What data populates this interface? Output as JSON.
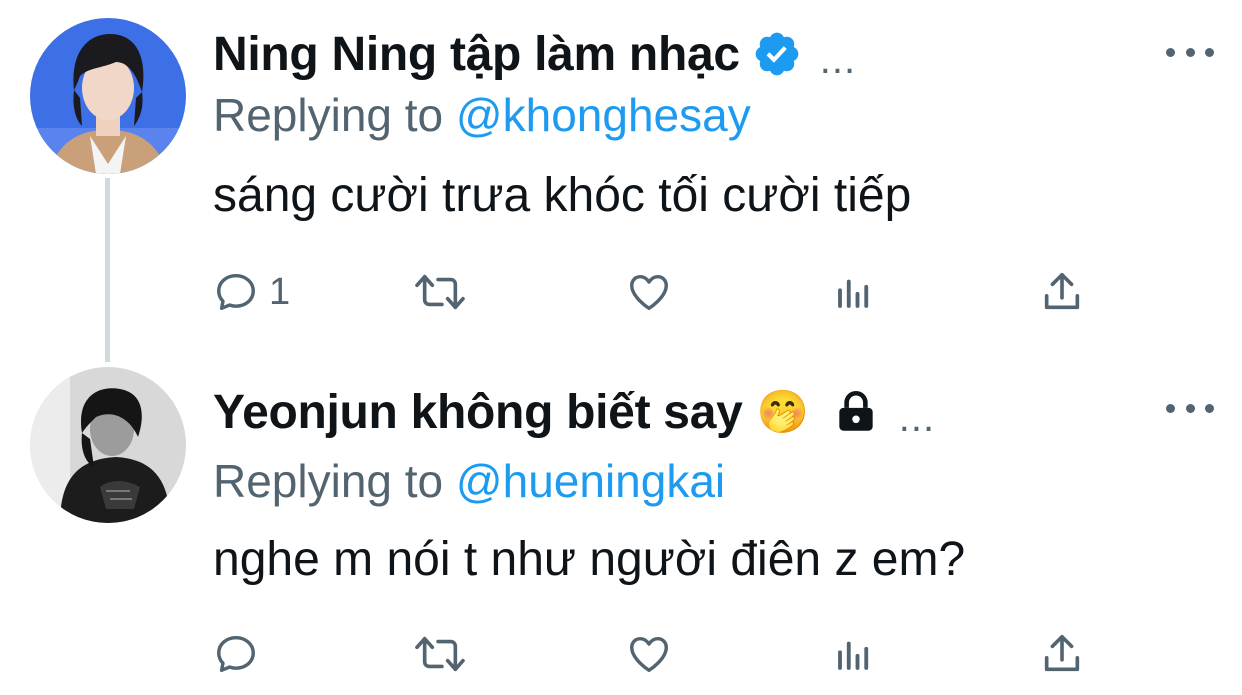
{
  "tweets": [
    {
      "display_name": "Ning Ning tập làm nhạc",
      "verified": true,
      "replying_prefix": "Replying to",
      "replying_handle": "@khonghesay",
      "text": "sáng cười trưa khóc tối cười tiếp",
      "reply_count": "1",
      "header_more": "..."
    },
    {
      "display_name": "Yeonjun không biết say",
      "emoji": "🤭",
      "protected": true,
      "replying_prefix": "Replying to",
      "replying_handle": "@hueningkai",
      "text": "nghe m nói t như người điên z em?",
      "reply_count": "",
      "header_more": "..."
    }
  ],
  "colors": {
    "text": "#0f1419",
    "secondary": "#536471",
    "link": "#1d9bf0",
    "verified": "#1d9bf0",
    "thread_line": "#cfd9de"
  },
  "icons": [
    "reply-icon",
    "retweet-icon",
    "like-icon",
    "views-icon",
    "share-icon",
    "verified-badge-icon",
    "lock-icon",
    "more-icon"
  ]
}
